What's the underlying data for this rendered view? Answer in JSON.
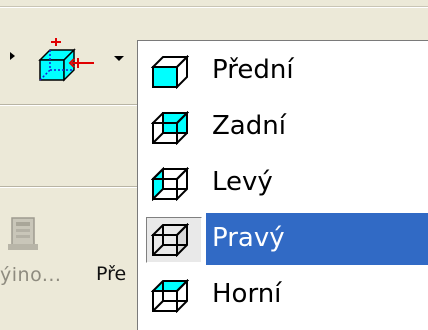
{
  "toolbar": {
    "truncated_label": "ýino...",
    "pre_label": "Pře"
  },
  "menu": {
    "items": [
      {
        "label": "Přední",
        "icon": "cube-front-icon",
        "selected": false
      },
      {
        "label": "Zadní",
        "icon": "cube-back-icon",
        "selected": false
      },
      {
        "label": "Levý",
        "icon": "cube-left-icon",
        "selected": false
      },
      {
        "label": "Pravý",
        "icon": "cube-right-icon",
        "selected": true
      },
      {
        "label": "Horní",
        "icon": "cube-top-icon",
        "selected": false
      }
    ]
  },
  "colors": {
    "toolbar_bg": "#ece9d8",
    "selection": "#316ac5",
    "cube_face": "#00ffff"
  }
}
